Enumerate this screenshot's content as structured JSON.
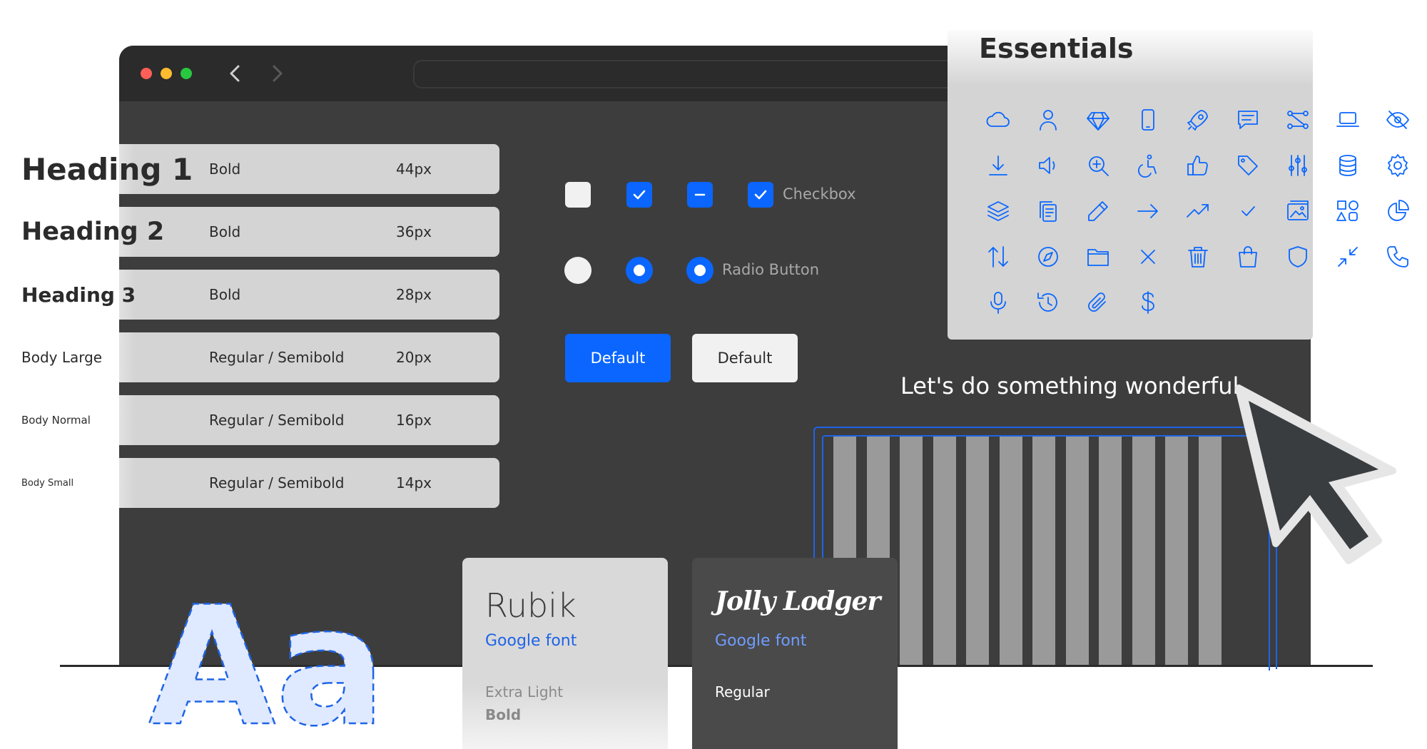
{
  "browser": {
    "window_controls": {
      "close_color": "#ff5f57",
      "minimize_color": "#febc2e",
      "zoom_color": "#28c840"
    },
    "back_icon": "chevron-left-icon",
    "forward_icon": "chevron-right-icon",
    "address_value": ""
  },
  "type_scale": [
    {
      "name": "Heading 1",
      "weight": "Bold",
      "size": "44px"
    },
    {
      "name": "Heading 2",
      "weight": "Bold",
      "size": "36px"
    },
    {
      "name": "Heading 3",
      "weight": "Bold",
      "size": "28px"
    },
    {
      "name": "Body Large",
      "weight": "Regular / Semibold",
      "size": "20px"
    },
    {
      "name": "Body Normal",
      "weight": "Regular / Semibold",
      "size": "16px"
    },
    {
      "name": "Body Small",
      "weight": "Regular / Semibold",
      "size": "14px"
    }
  ],
  "controls": {
    "checkbox_label": "Checkbox",
    "checkbox_states": [
      "unchecked",
      "checked",
      "indeterminate",
      "checked"
    ],
    "radio_label": "Radio Button",
    "radio_states": [
      "unselected",
      "selected",
      "selected"
    ],
    "primary_button": "Default",
    "secondary_button": "Default"
  },
  "essentials": {
    "title": "Essentials",
    "icons": [
      "cloud-icon",
      "user-icon",
      "diamond-icon",
      "smartphone-icon",
      "rocket-icon",
      "message-icon",
      "share-nodes-icon",
      "laptop-icon",
      "eye-off-icon",
      "download-icon",
      "volume-icon",
      "zoom-in-icon",
      "accessibility-icon",
      "thumbs-up-icon",
      "tag-icon",
      "sliders-icon",
      "database-icon",
      "settings-icon",
      "layers-icon",
      "copy-icon",
      "pencil-icon",
      "arrow-right-icon",
      "trending-up-icon",
      "check-icon",
      "image-gallery-icon",
      "shapes-icon",
      "pie-chart-icon",
      "sort-arrows-icon",
      "compass-icon",
      "folder-icon",
      "close-icon",
      "trash-icon",
      "shopping-bag-icon",
      "shield-icon",
      "minimize-icon",
      "phone-icon",
      "microphone-icon",
      "history-icon",
      "paperclip-icon",
      "dollar-icon"
    ]
  },
  "tagline": "Let's do something wonderful",
  "font_cards": [
    {
      "name": "Rubik",
      "link": "Google font",
      "weights": [
        "Extra Light",
        "Bold"
      ]
    },
    {
      "name": "Jolly Lodger",
      "link": "Google font",
      "weights": [
        "Regular"
      ]
    }
  ],
  "specimen": {
    "text": "Aa"
  },
  "colors": {
    "accent": "#0a66ff",
    "window": "#3d3d3d",
    "titlebar": "#2b2b2b",
    "bar": "#d4d4d4"
  }
}
